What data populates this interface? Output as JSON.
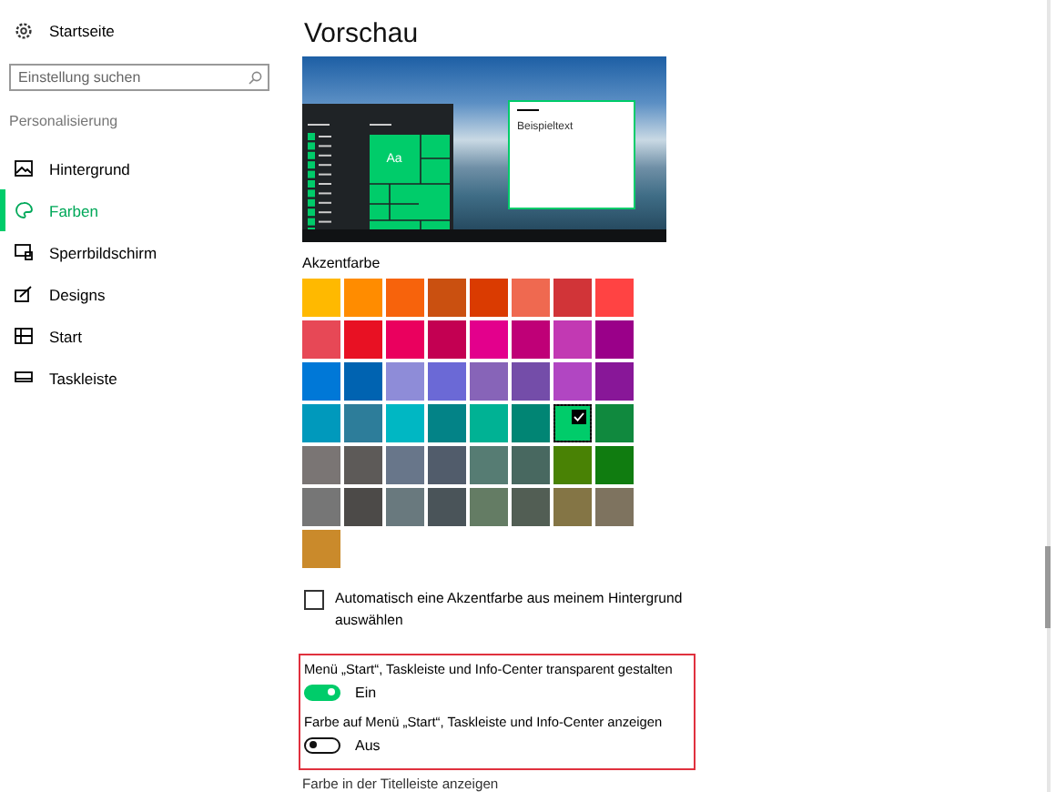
{
  "sidebar": {
    "home": "Startseite",
    "search": {
      "placeholder": "Einstellung suchen"
    },
    "section": "Personalisierung",
    "items": [
      {
        "label": "Hintergrund",
        "kind": "image",
        "selected": false
      },
      {
        "label": "Farben",
        "kind": "palette",
        "selected": true
      },
      {
        "label": "Sperrbildschirm",
        "kind": "lock",
        "selected": false
      },
      {
        "label": "Designs",
        "kind": "brush",
        "selected": false
      },
      {
        "label": "Start",
        "kind": "start",
        "selected": false
      },
      {
        "label": "Taskleiste",
        "kind": "taskbar",
        "selected": false
      }
    ]
  },
  "main": {
    "title": "Vorschau",
    "preview": {
      "sample_text": "Beispieltext",
      "tile_text": "Aa"
    },
    "accent": {
      "label": "Akzentfarbe",
      "swatches": [
        {
          "color": "#ffb900",
          "selected": false
        },
        {
          "color": "#ff8c00",
          "selected": false
        },
        {
          "color": "#f7630c",
          "selected": false
        },
        {
          "color": "#ca5010",
          "selected": false
        },
        {
          "color": "#da3b01",
          "selected": false
        },
        {
          "color": "#ef6950",
          "selected": false
        },
        {
          "color": "#d13438",
          "selected": false
        },
        {
          "color": "#ff4343",
          "selected": false
        },
        {
          "color": "#e74856",
          "selected": false
        },
        {
          "color": "#e81123",
          "selected": false
        },
        {
          "color": "#ea005e",
          "selected": false
        },
        {
          "color": "#c30052",
          "selected": false
        },
        {
          "color": "#e3008c",
          "selected": false
        },
        {
          "color": "#bf0077",
          "selected": false
        },
        {
          "color": "#c239b3",
          "selected": false
        },
        {
          "color": "#9a0089",
          "selected": false
        },
        {
          "color": "#0078d7",
          "selected": false
        },
        {
          "color": "#0063b1",
          "selected": false
        },
        {
          "color": "#8e8cd8",
          "selected": false
        },
        {
          "color": "#6b69d6",
          "selected": false
        },
        {
          "color": "#8764b8",
          "selected": false
        },
        {
          "color": "#744da9",
          "selected": false
        },
        {
          "color": "#b146c2",
          "selected": false
        },
        {
          "color": "#881798",
          "selected": false
        },
        {
          "color": "#0099bc",
          "selected": false
        },
        {
          "color": "#2d7d9a",
          "selected": false
        },
        {
          "color": "#00b7c3",
          "selected": false
        },
        {
          "color": "#038387",
          "selected": false
        },
        {
          "color": "#00b294",
          "selected": false
        },
        {
          "color": "#018574",
          "selected": false
        },
        {
          "color": "#00cc6a",
          "selected": true
        },
        {
          "color": "#10893e",
          "selected": false
        },
        {
          "color": "#7a7574",
          "selected": false
        },
        {
          "color": "#5d5a58",
          "selected": false
        },
        {
          "color": "#68768a",
          "selected": false
        },
        {
          "color": "#515c6b",
          "selected": false
        },
        {
          "color": "#567c73",
          "selected": false
        },
        {
          "color": "#486860",
          "selected": false
        },
        {
          "color": "#498205",
          "selected": false
        },
        {
          "color": "#107c10",
          "selected": false
        },
        {
          "color": "#767676",
          "selected": false
        },
        {
          "color": "#4c4a48",
          "selected": false
        },
        {
          "color": "#69797e",
          "selected": false
        },
        {
          "color": "#4a5459",
          "selected": false
        },
        {
          "color": "#647c64",
          "selected": false
        },
        {
          "color": "#525e54",
          "selected": false
        },
        {
          "color": "#847545",
          "selected": false
        },
        {
          "color": "#7e735f",
          "selected": false
        },
        {
          "color": "#ca8a2b",
          "selected": false
        }
      ]
    },
    "auto_accent": {
      "label": "Automatisch eine Akzentfarbe aus meinem Hintergrund auswählen",
      "checked": false
    },
    "toggles": [
      {
        "label": "Menü „Start“, Taskleiste und Info-Center transparent gestalten",
        "on": true,
        "state": "Ein"
      },
      {
        "label": "Farbe auf Menü „Start“, Taskleiste und Info-Center anzeigen",
        "on": false,
        "state": "Aus"
      }
    ],
    "cut_label": "Farbe in der Titelleiste anzeigen"
  }
}
